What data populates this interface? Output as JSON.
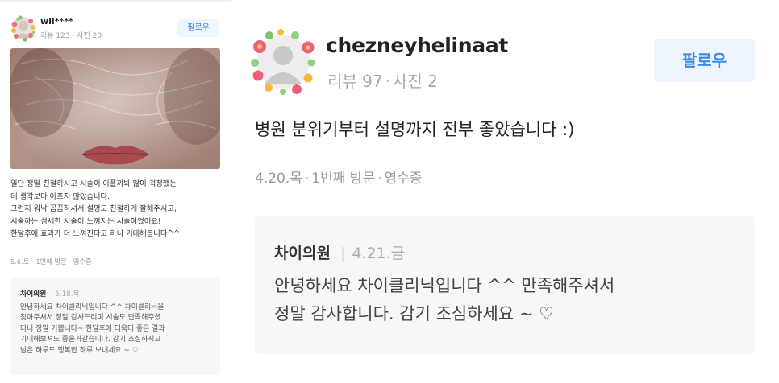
{
  "left_review": {
    "username": "wil****",
    "stats": "리뷰 123 · 사진 20",
    "follow_label": "팔로우",
    "text_lines": [
      "일단 정말 친절하시고 시술이 아플까봐 많이 걱정했는",
      "데 생각보다 아프지 않았습니다.",
      "그런지 워낙 꼼꼼하셔서 설명도 친절하게 잘해주시고,",
      "시술하는 섬세한 시술이 느껴지는 시술이었어요!",
      "한달후에 효과가 더 느껴진다고 하니 기대해봅니다^^"
    ],
    "meta": "5.6.토 · 1번째 방문 · 영수증",
    "reply": {
      "author": "차이의원",
      "date": "5.18.목",
      "lines": [
        "안녕하세요 차이클리닉입니다 ^^ 차이클리닉을",
        "찾아주셔서 정말 감사드리며 시술도 만족해주셨",
        "다니 정말 기쁩니다~ 한달후에 더욱더 좋은 결과",
        "기대해보셔도 좋을거같습니다. 감기 조심하시고",
        "남은 하루도 행복한 하루 보내세요 ~ ♡"
      ]
    }
  },
  "right_review": {
    "username": "chezneyhelinaat",
    "reviews": "리뷰 97",
    "photos": "사진 2",
    "follow_label": "팔로우",
    "text": "병원 분위기부터 설명까지 전부 좋았습니다 :)",
    "date": "4.20.목",
    "visit": "1번째 방문",
    "receipt": "영수증",
    "reply": {
      "author": "차이의원",
      "date": "4.21.금",
      "lines": [
        "안녕하세요 차이클리닉입니다 ^^ 만족해주셔서",
        "정말 감사합니다. 감기 조심하세요 ~ ♡"
      ]
    }
  },
  "colors": {
    "follow_text": "#3a8bf0",
    "follow_bg": "#eef5ff",
    "reply_bg": "#f6f7f9",
    "muted": "#999999"
  },
  "icons": [
    "flower-wreath-avatar-icon",
    "default-profile-icon"
  ]
}
